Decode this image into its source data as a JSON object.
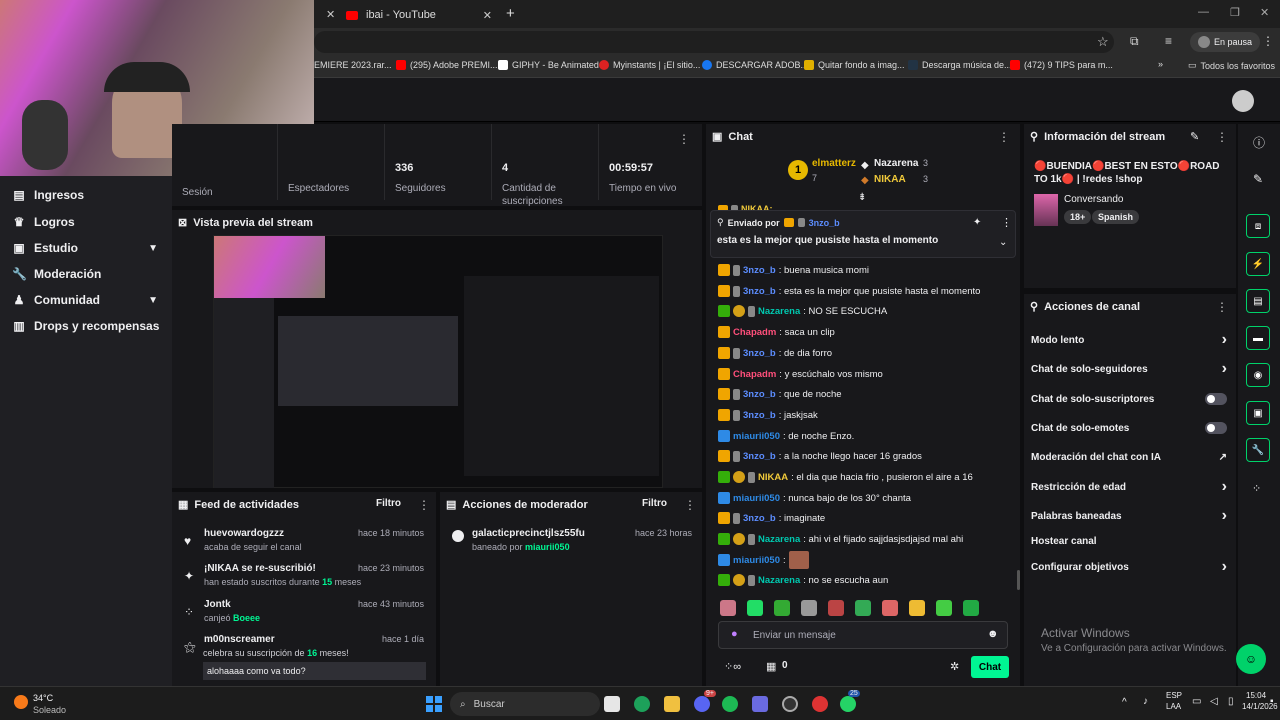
{
  "browser": {
    "tabs": [
      {
        "title": "ibai - YouTube"
      }
    ],
    "new_tab": "+",
    "profile_label": "En pausa",
    "bookmarks": [
      {
        "label": "EMIERE 2023.rar..."
      },
      {
        "label": "(295) Adobe PREMI..."
      },
      {
        "label": "GIPHY - Be Animated"
      },
      {
        "label": "Myinstants | ¡El sitio..."
      },
      {
        "label": "DESCARGAR ADOB..."
      },
      {
        "label": "Quitar fondo a imag..."
      },
      {
        "label": "Descarga música de..."
      },
      {
        "label": "(472) 9 TIPS para m..."
      },
      {
        "label": "Todos los favoritos"
      }
    ]
  },
  "sidebar": {
    "items": [
      {
        "label": "Ingresos",
        "icon": "revenue-icon"
      },
      {
        "label": "Logros",
        "icon": "trophy-icon"
      },
      {
        "label": "Estudio",
        "icon": "studio-icon"
      },
      {
        "label": "Moderación",
        "icon": "wrench-icon"
      },
      {
        "label": "Comunidad",
        "icon": "community-icon"
      },
      {
        "label": "Drops y recompensas",
        "icon": "gift-icon"
      }
    ]
  },
  "stats": {
    "session_label": "Sesión",
    "viewers_label": "Espectadores",
    "followers_value": "336",
    "followers_label": "Seguidores",
    "subs_value": "4",
    "subs_label": "Cantidad de suscripciones",
    "live_value": "00:59:57",
    "live_label": "Tiempo en vivo"
  },
  "preview": {
    "title": "Vista previa del stream"
  },
  "feed": {
    "title": "Feed de actividades",
    "filter": "Filtro",
    "items": [
      {
        "name": "huevowardogzzz",
        "time": "hace 18 minutos",
        "sub": "acaba de seguir el canal"
      },
      {
        "name": "¡NIKAA se re-suscribió!",
        "time": "hace 23 minutos",
        "sub_a": "han estado suscritos durante ",
        "sub_b": "15",
        "sub_c": " meses"
      },
      {
        "name": "Jontk",
        "time": "hace 43 minutos",
        "sub_a": "canjeó ",
        "sub_b": "Boeee"
      },
      {
        "name": "m00nscreamer",
        "time": "hace 1 día",
        "sub_a": "celebra su suscripción de ",
        "sub_b": "16",
        "sub_c": " meses!",
        "message": "alohaaaa como va todo?"
      }
    ]
  },
  "modactions": {
    "title": "Acciones de moderador",
    "filter": "Filtro",
    "item": {
      "name": "galacticprecinctjlsz55fu",
      "time": "hace 23 horas",
      "sub": "baneado por ",
      "by": "miaurii050"
    }
  },
  "chat": {
    "title": "Chat",
    "leaderboard": [
      {
        "name": "elmatterz",
        "count": "7"
      },
      {
        "name": "Nazarena",
        "count": "3"
      },
      {
        "name": "NIKAA",
        "count": "3"
      }
    ],
    "pinned": {
      "by_label": "Enviado por",
      "by_user": "3nzo_b",
      "text": "esta es la mejor que pusiste hasta el momento"
    },
    "partial_user": "NIKAA: ",
    "messages": [
      {
        "user": "3nzo_b",
        "text": ": buena musica momi",
        "color": "#5c8dff",
        "badges": [
          "crown",
          "ph"
        ]
      },
      {
        "user": "3nzo_b",
        "text": ": esta es la mejor que pusiste hasta el momento",
        "color": "#5c8dff",
        "badges": [
          "crown",
          "ph"
        ]
      },
      {
        "user": "Nazarena",
        "text": ": NO SE ESCUCHA",
        "color": "#00c8af",
        "badges": [
          "mod",
          "tier",
          "ph"
        ]
      },
      {
        "user": "Chapadm",
        "text": ": saca un clip",
        "color": "#ff4f7b",
        "badges": [
          "crown"
        ]
      },
      {
        "user": "3nzo_b",
        "text": ": de dia forro",
        "color": "#5c8dff",
        "badges": [
          "crown",
          "ph"
        ]
      },
      {
        "user": "Chapadm",
        "text": ": y escúchalo vos mismo",
        "color": "#ff4f7b",
        "badges": [
          "crown"
        ]
      },
      {
        "user": "3nzo_b",
        "text": ": que de noche",
        "color": "#5c8dff",
        "badges": [
          "crown",
          "ph"
        ]
      },
      {
        "user": "3nzo_b",
        "text": ": jaskjsak",
        "color": "#5c8dff",
        "badges": [
          "crown",
          "ph"
        ]
      },
      {
        "user": "miaurii050",
        "text": ": de noche Enzo.",
        "color": "#2e8ae6",
        "badges": [
          "vip"
        ]
      },
      {
        "user": "3nzo_b",
        "text": ": a la noche llego hacer 16 grados",
        "color": "#5c8dff",
        "badges": [
          "crown",
          "ph"
        ]
      },
      {
        "user": "NIKAA",
        "text": ": el dia que hacia frio , pusieron el aire a 16",
        "color": "#f0c93a",
        "badges": [
          "mod",
          "tier",
          "ph"
        ]
      },
      {
        "user": "miaurii050",
        "text": ": nunca bajo de los 30° chanta",
        "color": "#2e8ae6",
        "badges": [
          "vip"
        ]
      },
      {
        "user": "3nzo_b",
        "text": ": imaginate",
        "color": "#5c8dff",
        "badges": [
          "crown",
          "ph"
        ]
      },
      {
        "user": "Nazarena",
        "text": ": ahi vi el fijado sajjdasjsdjajsd mal ahi",
        "color": "#00c8af",
        "badges": [
          "mod",
          "tier",
          "ph"
        ]
      },
      {
        "user": "miaurii050",
        "text": ":",
        "color": "#2e8ae6",
        "badges": [
          "vip"
        ],
        "emote": true
      },
      {
        "user": "Nazarena",
        "text": ": no se escucha aun",
        "color": "#00c8af",
        "badges": [
          "mod",
          "tier",
          "ph"
        ]
      }
    ],
    "input_placeholder": "Enviar un mensaje",
    "points": "0",
    "send_label": "Chat"
  },
  "streaminfo": {
    "title": "Información del stream",
    "stream_title": "🔴BUENDIA🔴BEST EN ESTO🔴ROAD TO 1k🔴 | !redes !shop",
    "category": "Conversando",
    "tags": [
      "18+",
      "Spanish"
    ]
  },
  "channelactions": {
    "title": "Acciones de canal",
    "items": [
      {
        "label": "Modo lento",
        "ctrl": "chevron"
      },
      {
        "label": "Chat de solo-seguidores",
        "ctrl": "chevron"
      },
      {
        "label": "Chat de solo-suscriptores",
        "ctrl": "toggle"
      },
      {
        "label": "Chat de solo-emotes",
        "ctrl": "toggle"
      },
      {
        "label": "Moderación del chat con IA",
        "ctrl": "external"
      },
      {
        "label": "Restricción de edad",
        "ctrl": "chevron"
      },
      {
        "label": "Palabras baneadas",
        "ctrl": "chevron"
      },
      {
        "label": "Hostear canal",
        "ctrl": "none"
      },
      {
        "label": "Configurar objetivos",
        "ctrl": "chevron"
      }
    ]
  },
  "watermark": {
    "line1": "Activar Windows",
    "line2": "Ve a Configuración para activar Windows."
  },
  "taskbar": {
    "weather_temp": "34°C",
    "weather_desc": "Soleado",
    "search": "Buscar",
    "lang1": "ESP",
    "lang2": "LAA",
    "time": "15:04",
    "date": "14/1/2026",
    "badge_teams": "25",
    "badge_msg": "9+"
  },
  "colors": {
    "accent": "#00f593",
    "twitch_bg": "#0e0e10",
    "panel": "#18181b"
  }
}
